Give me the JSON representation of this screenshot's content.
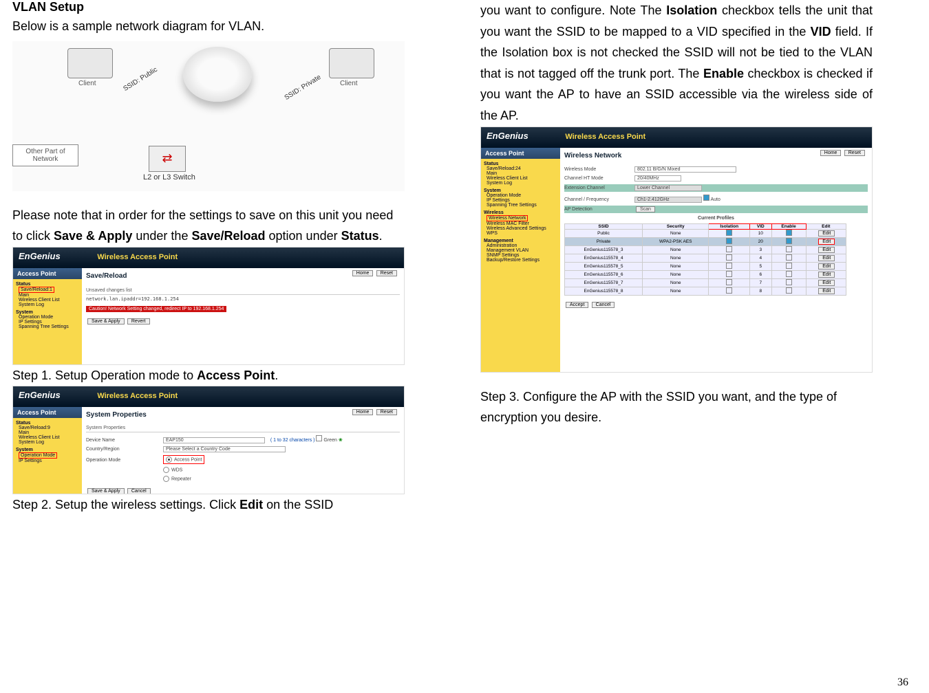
{
  "page_number": "36",
  "left": {
    "heading": "VLAN Setup",
    "intro": "Below is a sample network diagram for VLAN.",
    "diagram": {
      "client_left": "Client",
      "client_right": "Client",
      "ssid_public": "SSID: Public",
      "ssid_private": "SSID: Private",
      "other_net": "Other Part of Network",
      "switch_label": "L2 or L3 Switch"
    },
    "note_p1": "Please note that in order for the settings to save on this unit you need to click ",
    "note_b1": "Save & Apply",
    "note_p2": " under the ",
    "note_b2": "Save/Reload",
    "note_p3": " option under ",
    "note_b3": "Status",
    "note_p4": ".",
    "ui1": {
      "brand": "EnGenius",
      "top_title": "Wireless Access Point",
      "side_header": "Access Point",
      "sec_status": "Status",
      "it_savereload": "Save/Reload:1",
      "it_main": "Main",
      "it_wclist": "Wireless Client List",
      "it_system_log": "System Log",
      "sec_system": "System",
      "it_opmode": "Operation Mode",
      "it_ip": "IP Settings",
      "it_stp": "Spanning Tree Settings",
      "main_title": "Save/Reload",
      "home": "Home",
      "reset": "Reset",
      "unsaved": "Unsaved changes list",
      "pre_text": "network.lan.ipaddr=192.168.1.254",
      "caution": "Caution!  Network Setting changed, redirect IP to 192.168.1.254",
      "btn_saveapply": "Save & Apply",
      "btn_revert": "Revert"
    },
    "step1": "Step 1. Setup Operation mode to ",
    "step1_b": "Access Point",
    "step1_end": ".",
    "ui2": {
      "brand": "EnGenius",
      "top_title": "Wireless Access Point",
      "side_header": "Access Point",
      "sec_status": "Status",
      "it_savereload": "Save/Reload:9",
      "it_main": "Main",
      "it_wclist": "Wireless Client List",
      "it_system_log": "System Log",
      "sec_system": "System",
      "it_opmode": "Operation Mode",
      "it_ip": "IP Settings",
      "main_title": "System Properties",
      "home": "Home",
      "reset": "Reset",
      "subhdr": "System Properties",
      "dev_name_lbl": "Device Name",
      "dev_name_val": "EAP150",
      "dev_name_note": "( 1 to 32 characters )",
      "green_lbl": "Green",
      "country_lbl": "Country/Region",
      "country_val": "Please Select a Country Code",
      "opmode_lbl": "Operation Mode",
      "mode_ap": "Access Point",
      "mode_wds": "WDS",
      "mode_rep": "Repeater",
      "btn_saveapply": "Save & Apply",
      "btn_cancel": "Cancel"
    },
    "step2_p1": "Step 2. Setup the wireless settings. Click ",
    "step2_b1": "Edit",
    "step2_p2": " on the SSID"
  },
  "right": {
    "cont": {
      "p1": "you want to configure. Note The ",
      "b1": "Isolation",
      "p2": " checkbox tells the unit that you want the SSID to be mapped to a VID specified in the ",
      "b2": "VID",
      "p3": " field. If the Isolation box is not checked the SSID will not be tied to the VLAN that is not tagged off the trunk port. The ",
      "b3": "Enable",
      "p4": " checkbox is checked if you want the AP to have an SSID accessible via the wireless side of the AP."
    },
    "ui3": {
      "brand": "EnGenius",
      "top_title": "Wireless Access Point",
      "side_header": "Access Point",
      "sec_status": "Status",
      "it_savereload": "Save/Reload:24",
      "it_main": "Main",
      "it_wclist": "Wireless Client List",
      "it_system_log": "System Log",
      "sec_system": "System",
      "it_opmode": "Operation Mode",
      "it_ip": "IP Settings",
      "it_stp": "Spanning Tree Settings",
      "sec_wireless": "Wireless",
      "it_wnet": "Wireless Network",
      "it_wmac": "Wireless MAC Filter",
      "it_wadv": "Wireless Advanced Settings",
      "it_wps": "WPS",
      "sec_mgmt": "Management",
      "it_admin": "Administration",
      "it_mvlan": "Management VLAN",
      "it_snmp": "SNMP Settings",
      "it_backup": "Backup/Restore Settings",
      "main_title": "Wireless Network",
      "home": "Home",
      "reset": "Reset",
      "wmode_lbl": "Wireless Mode",
      "wmode_val": "802.11 B/G/N Mixed",
      "htmode_lbl": "Channel HT Mode",
      "htmode_val": "20/40MHz",
      "ext_lbl": "Extension Channel",
      "ext_val": "Lower Channel",
      "chan_lbl": "Channel / Frequency",
      "chan_val": "Ch1-2.412GHz",
      "chan_auto": "Auto",
      "apd_lbl": "AP Detection",
      "apd_btn": "Scan",
      "cp_title": "Current Profiles",
      "th_ssid": "SSID",
      "th_sec": "Security",
      "th_iso": "Isolation",
      "th_vid": "VID",
      "th_en": "Enable",
      "th_edit": "Edit",
      "rows": [
        {
          "ssid": "Public",
          "sec": "None",
          "iso": true,
          "vid": "10",
          "en": true,
          "red": false
        },
        {
          "ssid": "Private",
          "sec": "WPA2-PSK AES",
          "iso": true,
          "vid": "20",
          "en": true,
          "red": true
        },
        {
          "ssid": "EnGenius115578_3",
          "sec": "None",
          "iso": false,
          "vid": "3",
          "en": false,
          "red": false
        },
        {
          "ssid": "EnGenius115578_4",
          "sec": "None",
          "iso": false,
          "vid": "4",
          "en": false,
          "red": false
        },
        {
          "ssid": "EnGenius115578_5",
          "sec": "None",
          "iso": false,
          "vid": "5",
          "en": false,
          "red": false
        },
        {
          "ssid": "EnGenius115578_6",
          "sec": "None",
          "iso": false,
          "vid": "6",
          "en": false,
          "red": false
        },
        {
          "ssid": "EnGenius115578_7",
          "sec": "None",
          "iso": false,
          "vid": "7",
          "en": false,
          "red": false
        },
        {
          "ssid": "EnGenius115578_8",
          "sec": "None",
          "iso": false,
          "vid": "8",
          "en": false,
          "red": false
        }
      ],
      "edit_btn": "Edit",
      "btn_accept": "Accept",
      "btn_cancel": "Cancel"
    },
    "step3": "Step 3. Configure the AP with the SSID you want, and the type of encryption you desire."
  }
}
